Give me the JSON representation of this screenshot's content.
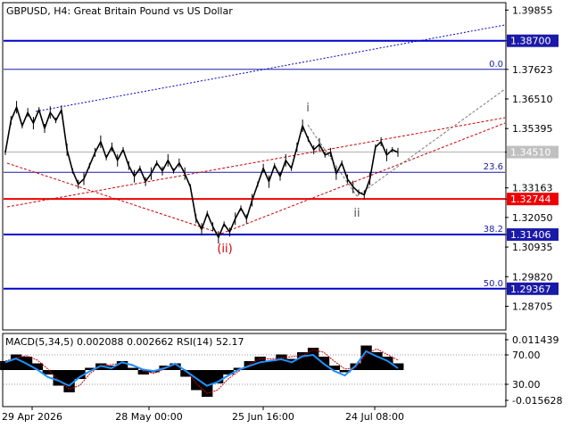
{
  "chart_data": [
    {
      "type": "line",
      "symbol": "GBPUSD",
      "timeframe": "H4",
      "description": "Great Britain Pound vs US Dollar",
      "title": "GBPUSD, H4:  Great Britain Pound vs US Dollar",
      "ylim": [
        1.2785,
        1.401
      ],
      "y_ticks": [
        1.39855,
        1.387,
        1.37623,
        1.3651,
        1.35395,
        1.3451,
        1.33163,
        1.32744,
        1.3205,
        1.31406,
        1.30935,
        1.2982,
        1.29367,
        1.28705
      ],
      "x_ticks": [
        "29 Apr 2026",
        "28 May 00:00",
        "25 Jun 16:00",
        "24 Jul 08:00"
      ],
      "current_price": 1.3451,
      "horizontal_levels": [
        {
          "value": 1.387,
          "label": "1.38700",
          "color": "#0000cc"
        },
        {
          "value": 1.32744,
          "label": "1.32744",
          "color": "#ee0000"
        },
        {
          "value": 1.31406,
          "label": "1.31406",
          "color": "#0000cc"
        },
        {
          "value": 1.29367,
          "label": "1.29367",
          "color": "#0000cc"
        }
      ],
      "fibonacci_levels": [
        {
          "ratio": "0.0",
          "value": 1.37623
        },
        {
          "ratio": "23.6",
          "value": 1.3375
        },
        {
          "ratio": "38.2",
          "value": 1.31406
        },
        {
          "ratio": "50.0",
          "value": 1.29367
        }
      ],
      "wave_labels": [
        {
          "text": "i",
          "color": "#555555"
        },
        {
          "text": "ii",
          "color": "#555555"
        },
        {
          "text": "(ii)",
          "color": "#cc0000"
        }
      ],
      "price_path": [
        1.345,
        1.357,
        1.362,
        1.355,
        1.36,
        1.356,
        1.361,
        1.354,
        1.36,
        1.357,
        1.361,
        1.346,
        1.338,
        1.333,
        1.335,
        1.34,
        1.345,
        1.349,
        1.343,
        1.347,
        1.342,
        1.346,
        1.34,
        1.336,
        1.339,
        1.334,
        1.337,
        1.341,
        1.338,
        1.342,
        1.338,
        1.341,
        1.337,
        1.332,
        1.32,
        1.316,
        1.322,
        1.317,
        1.313,
        1.318,
        1.315,
        1.32,
        1.324,
        1.32,
        1.327,
        1.333,
        1.339,
        1.334,
        1.34,
        1.336,
        1.342,
        1.339,
        1.347,
        1.355,
        1.35,
        1.346,
        1.348,
        1.344,
        1.345,
        1.337,
        1.341,
        1.335,
        1.332,
        1.33,
        1.329,
        1.335,
        1.347,
        1.349,
        1.344,
        1.346,
        1.345
      ]
    },
    {
      "type": "line",
      "title": "MACD(5,34,5) 0.002088 0.002662 RSI(14) 52.17",
      "macd_label": "MACD(5,34,5)",
      "macd_main": 0.002088,
      "macd_signal": 0.002662,
      "rsi_label": "RSI(14)",
      "rsi_value": 52.17,
      "y_ticks_right": [
        "0.011439",
        "70.00",
        "30.00",
        "-0.015628"
      ],
      "rsi_levels": [
        70,
        30
      ],
      "series": [
        {
          "name": "MACD(5,34,5)",
          "values": [
            0.004,
            0.007,
            0.006,
            0.003,
            -0.002,
            -0.007,
            -0.01,
            -0.004,
            0.001,
            0.003,
            0.002,
            0.004,
            0.001,
            -0.002,
            -0.001,
            0.002,
            0.003,
            -0.003,
            -0.009,
            -0.012,
            -0.006,
            -0.002,
            0.001,
            0.004,
            0.006,
            0.004,
            0.007,
            0.005,
            0.008,
            0.01,
            0.006,
            0.002,
            -0.001,
            0.003,
            0.011,
            0.008,
            0.006,
            0.003
          ]
        },
        {
          "name": "RSI(14)",
          "values": [
            60,
            65,
            58,
            50,
            40,
            35,
            28,
            40,
            48,
            55,
            52,
            60,
            56,
            50,
            48,
            52,
            58,
            48,
            38,
            28,
            33,
            42,
            50,
            55,
            60,
            62,
            64,
            60,
            68,
            70,
            58,
            48,
            42,
            55,
            75,
            68,
            62,
            52
          ]
        }
      ]
    }
  ]
}
